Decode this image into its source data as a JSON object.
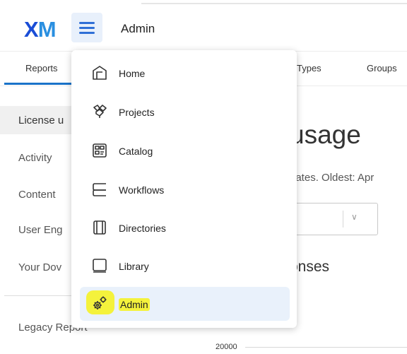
{
  "header": {
    "logo": {
      "part1": "X",
      "part2": "M"
    },
    "menu_button_icon": "hamburger-icon",
    "title": "Admin"
  },
  "tabs": [
    {
      "label": "Reports",
      "active": true
    },
    {
      "label": "Types"
    },
    {
      "label": "Groups"
    }
  ],
  "sidebar": {
    "items": [
      {
        "label": "License u",
        "active": true
      },
      {
        "label": "Activity"
      },
      {
        "label": "Content"
      },
      {
        "label": "User Eng"
      },
      {
        "label": "Your Dov"
      },
      {
        "label": "Legacy Report"
      }
    ]
  },
  "main": {
    "title": "usage",
    "subtitle": "dates. Oldest: Apr",
    "select_chevron": "∨",
    "section_heading": "onses",
    "axis_tick": "20000"
  },
  "menu": {
    "items": [
      {
        "label": "Home",
        "icon": "home-icon"
      },
      {
        "label": "Projects",
        "icon": "projects-icon"
      },
      {
        "label": "Catalog",
        "icon": "catalog-icon"
      },
      {
        "label": "Workflows",
        "icon": "workflows-icon"
      },
      {
        "label": "Directories",
        "icon": "directories-icon"
      },
      {
        "label": "Library",
        "icon": "library-icon"
      },
      {
        "label": "Admin",
        "icon": "admin-gear-icon",
        "selected": true,
        "highlighted": true
      }
    ]
  },
  "colors": {
    "accent": "#1a73c9",
    "logo_x": "#1a4dd6",
    "logo_m": "#2a8fe0",
    "selected_bg": "#e9f1fb",
    "highlighter": "#f4f23c"
  }
}
